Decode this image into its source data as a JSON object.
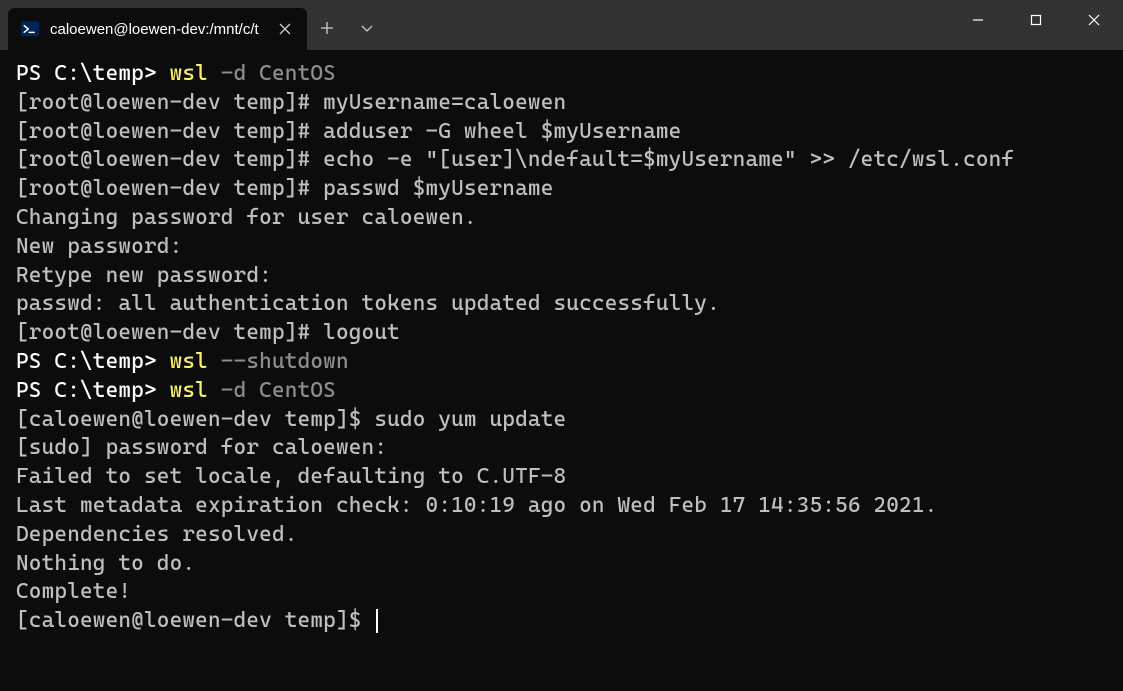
{
  "colors": {
    "bg": "#0c0c0c",
    "titlebar": "#333333",
    "text": "#cccccc",
    "white": "#ffffff",
    "yellow": "#f9f06b",
    "gray": "#8e8e8e"
  },
  "tab": {
    "title": "caloewen@loewen-dev:/mnt/c/t"
  },
  "lines": [
    {
      "segments": [
        {
          "cls": "white",
          "text": "PS C:\\temp> "
        },
        {
          "cls": "yellow",
          "text": "wsl "
        },
        {
          "cls": "gray",
          "text": "-d CentOS"
        }
      ]
    },
    {
      "segments": [
        {
          "cls": "dim-white",
          "text": "[root@loewen-dev temp]# myUsername=caloewen"
        }
      ]
    },
    {
      "segments": [
        {
          "cls": "dim-white",
          "text": "[root@loewen-dev temp]# adduser -G wheel $myUsername"
        }
      ]
    },
    {
      "segments": [
        {
          "cls": "dim-white",
          "text": "[root@loewen-dev temp]# echo -e \"[user]\\ndefault=$myUsername\" >> /etc/wsl.conf"
        }
      ]
    },
    {
      "segments": [
        {
          "cls": "dim-white",
          "text": "[root@loewen-dev temp]# passwd $myUsername"
        }
      ]
    },
    {
      "segments": [
        {
          "cls": "dim-white",
          "text": "Changing password for user caloewen."
        }
      ]
    },
    {
      "segments": [
        {
          "cls": "dim-white",
          "text": "New password:"
        }
      ]
    },
    {
      "segments": [
        {
          "cls": "dim-white",
          "text": "Retype new password:"
        }
      ]
    },
    {
      "segments": [
        {
          "cls": "dim-white",
          "text": "passwd: all authentication tokens updated successfully."
        }
      ]
    },
    {
      "segments": [
        {
          "cls": "dim-white",
          "text": "[root@loewen-dev temp]# logout"
        }
      ]
    },
    {
      "segments": [
        {
          "cls": "white",
          "text": "PS C:\\temp> "
        },
        {
          "cls": "yellow",
          "text": "wsl "
        },
        {
          "cls": "gray",
          "text": "--shutdown"
        }
      ]
    },
    {
      "segments": [
        {
          "cls": "white",
          "text": "PS C:\\temp> "
        },
        {
          "cls": "yellow",
          "text": "wsl "
        },
        {
          "cls": "gray",
          "text": "-d CentOS"
        }
      ]
    },
    {
      "segments": [
        {
          "cls": "dim-white",
          "text": "[caloewen@loewen-dev temp]$ sudo yum update"
        }
      ]
    },
    {
      "segments": [
        {
          "cls": "dim-white",
          "text": "[sudo] password for caloewen:"
        }
      ]
    },
    {
      "segments": [
        {
          "cls": "dim-white",
          "text": "Failed to set locale, defaulting to C.UTF-8"
        }
      ]
    },
    {
      "segments": [
        {
          "cls": "dim-white",
          "text": "Last metadata expiration check: 0:10:19 ago on Wed Feb 17 14:35:56 2021."
        }
      ]
    },
    {
      "segments": [
        {
          "cls": "dim-white",
          "text": "Dependencies resolved."
        }
      ]
    },
    {
      "segments": [
        {
          "cls": "dim-white",
          "text": "Nothing to do."
        }
      ]
    },
    {
      "segments": [
        {
          "cls": "dim-white",
          "text": "Complete!"
        }
      ]
    },
    {
      "segments": [
        {
          "cls": "dim-white",
          "text": "[caloewen@loewen-dev temp]$ "
        }
      ],
      "cursor": true
    }
  ]
}
